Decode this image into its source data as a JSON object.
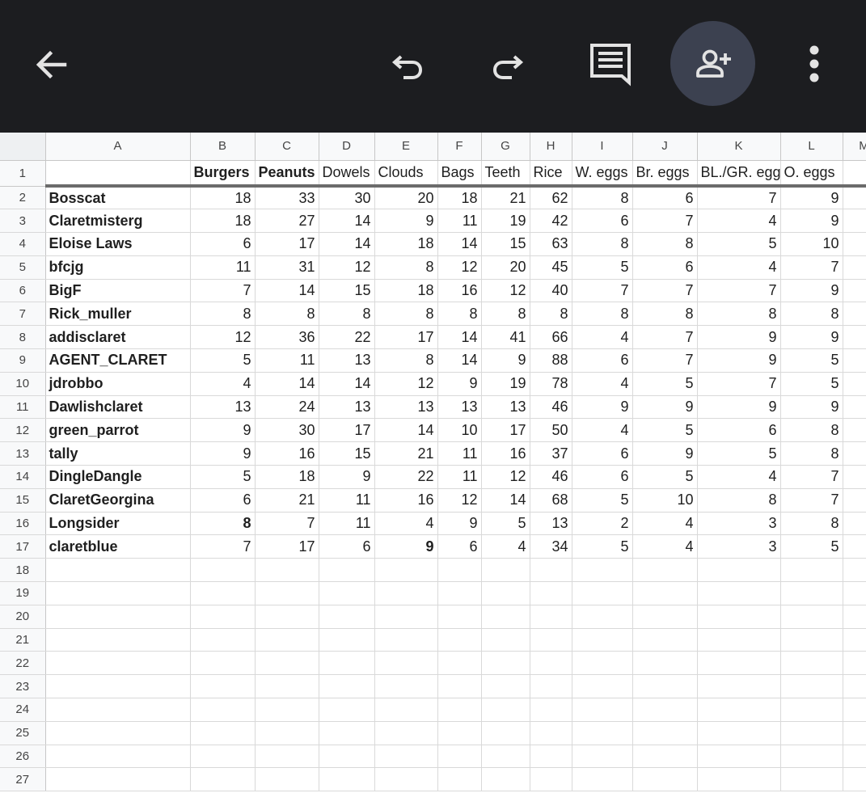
{
  "toolbar": {
    "icons": [
      "back-arrow-icon",
      "undo-icon",
      "redo-icon",
      "comment-icon",
      "add-person-icon",
      "more-vert-icon"
    ],
    "colors": {
      "bar": "#1c1d20",
      "icon": "#e3e3e3",
      "share_bg": "#3c4150"
    }
  },
  "sheet": {
    "columns": [
      "A",
      "B",
      "C",
      "D",
      "E",
      "F",
      "G",
      "H",
      "I",
      "J",
      "K",
      "L",
      "M"
    ],
    "headers": [
      "",
      "Burgers",
      "Peanuts",
      "Dowels",
      "Clouds",
      "Bags",
      "Teeth",
      "Rice",
      "W. eggs",
      "Br. eggs",
      "BL./GR. eggs",
      "O. eggs",
      ""
    ],
    "rows": [
      {
        "name": "Bosscat",
        "values": [
          18,
          33,
          30,
          20,
          18,
          21,
          62,
          8,
          6,
          7,
          9
        ]
      },
      {
        "name": "Claretmisterg",
        "values": [
          18,
          27,
          14,
          9,
          11,
          19,
          42,
          6,
          7,
          4,
          9
        ]
      },
      {
        "name": "Eloise Laws",
        "values": [
          6,
          17,
          14,
          18,
          14,
          15,
          63,
          8,
          8,
          5,
          10
        ]
      },
      {
        "name": "bfcjg",
        "values": [
          11,
          31,
          12,
          8,
          12,
          20,
          45,
          5,
          6,
          4,
          7
        ]
      },
      {
        "name": "BigF",
        "values": [
          7,
          14,
          15,
          18,
          16,
          12,
          40,
          7,
          7,
          7,
          9
        ]
      },
      {
        "name": "Rick_muller",
        "values": [
          8,
          8,
          8,
          8,
          8,
          8,
          8,
          8,
          8,
          8,
          8
        ]
      },
      {
        "name": "addisclaret",
        "values": [
          12,
          36,
          22,
          17,
          14,
          41,
          66,
          4,
          7,
          9,
          9
        ]
      },
      {
        "name": "AGENT_CLARET",
        "values": [
          5,
          11,
          13,
          8,
          14,
          9,
          88,
          6,
          7,
          9,
          5
        ]
      },
      {
        "name": "jdrobbo",
        "values": [
          4,
          14,
          14,
          12,
          9,
          19,
          78,
          4,
          5,
          7,
          5
        ]
      },
      {
        "name": "Dawlishclaret",
        "values": [
          13,
          24,
          13,
          13,
          13,
          13,
          46,
          9,
          9,
          9,
          9
        ]
      },
      {
        "name": "green_parrot",
        "values": [
          9,
          30,
          17,
          14,
          10,
          17,
          50,
          4,
          5,
          6,
          8
        ]
      },
      {
        "name": "tally",
        "values": [
          9,
          16,
          15,
          21,
          11,
          16,
          37,
          6,
          9,
          5,
          8
        ]
      },
      {
        "name": "DingleDangle",
        "values": [
          5,
          18,
          9,
          22,
          11,
          12,
          46,
          6,
          5,
          4,
          7
        ]
      },
      {
        "name": "ClaretGeorgina",
        "values": [
          6,
          21,
          11,
          16,
          12,
          14,
          68,
          5,
          10,
          8,
          7
        ]
      },
      {
        "name": "Longsider",
        "values": [
          8,
          7,
          11,
          4,
          9,
          5,
          13,
          2,
          4,
          3,
          8
        ],
        "bold": [
          0
        ]
      },
      {
        "name": "claretblue",
        "values": [
          7,
          17,
          6,
          9,
          6,
          4,
          34,
          5,
          4,
          3,
          5
        ],
        "bold": [
          3
        ]
      }
    ],
    "bold_headers": [
      1,
      2
    ],
    "last_row_number": 27
  }
}
